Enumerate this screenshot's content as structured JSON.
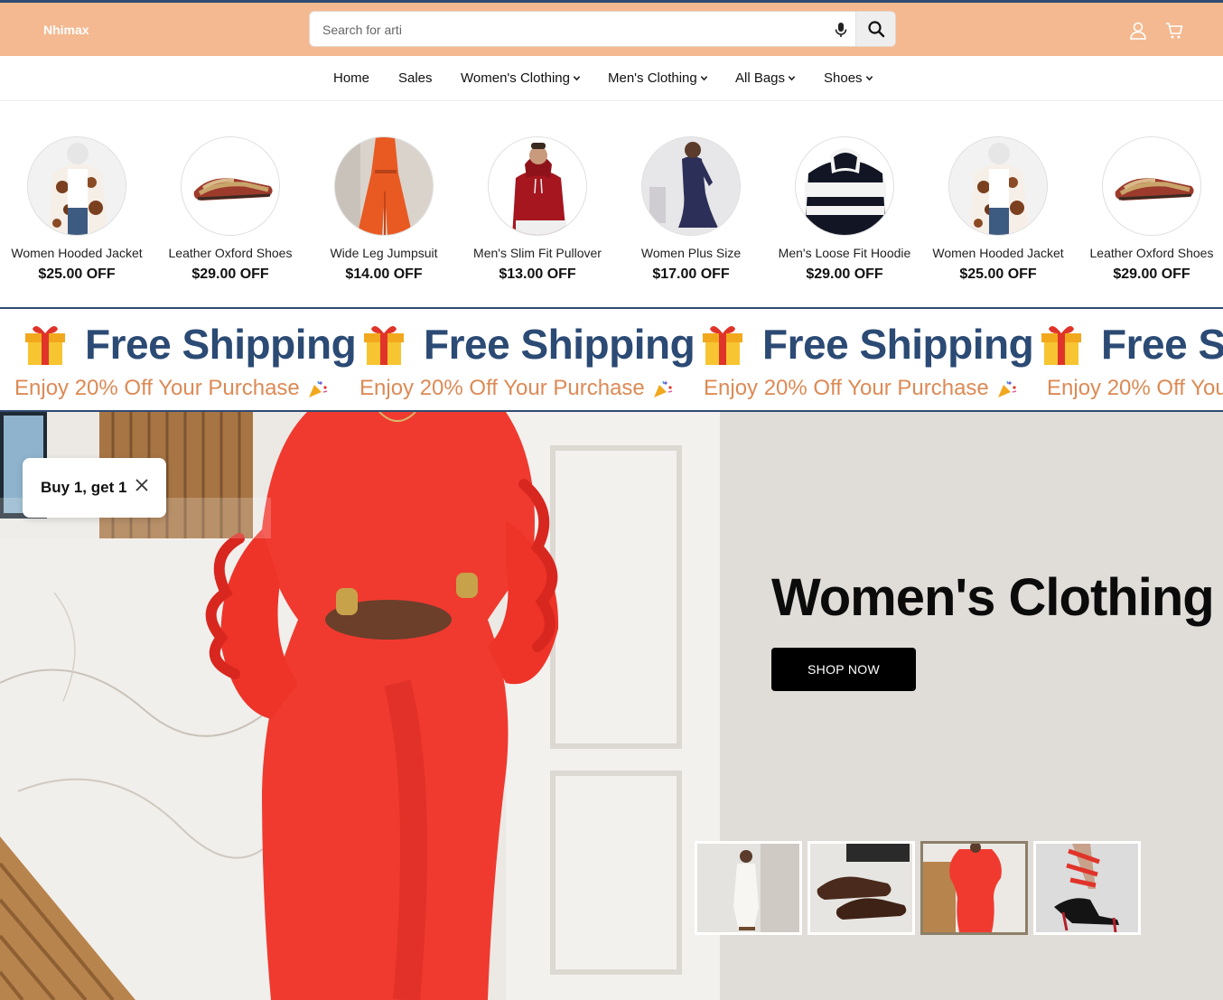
{
  "header": {
    "brand": "Nhimax",
    "search_placeholder": "Search for arti",
    "icons": [
      "mic-icon",
      "search-icon",
      "user-icon",
      "cart-icon"
    ]
  },
  "nav": {
    "items": [
      {
        "label": "Home",
        "dropdown": false
      },
      {
        "label": "Sales",
        "dropdown": false
      },
      {
        "label": "Women's Clothing",
        "dropdown": true
      },
      {
        "label": "Men's Clothing",
        "dropdown": true
      },
      {
        "label": "All Bags",
        "dropdown": true
      },
      {
        "label": "Shoes",
        "dropdown": true
      }
    ]
  },
  "categories": [
    {
      "name": "Women Hooded Jacket",
      "price": "$25.00 OFF"
    },
    {
      "name": "Leather Oxford Shoes",
      "price": "$29.00 OFF"
    },
    {
      "name": "Wide Leg Jumpsuit",
      "price": "$14.00 OFF"
    },
    {
      "name": "Men's Slim Fit Pullover",
      "price": "$13.00 OFF"
    },
    {
      "name": "Women Plus Size",
      "price": "$17.00 OFF"
    },
    {
      "name": "Men's Loose Fit Hoodie",
      "price": "$29.00 OFF"
    },
    {
      "name": "Women Hooded Jacket",
      "price": "$25.00 OFF"
    },
    {
      "name": "Leather Oxford Shoes",
      "price": "$29.00 OFF"
    }
  ],
  "promo": {
    "title": "Free Shipping",
    "subtitle": "Enjoy 20% Off Your Purchase"
  },
  "popup": {
    "text": "Buy 1, get 1"
  },
  "hero": {
    "title": "Women's Clothing",
    "button": "SHOP NOW",
    "active_thumbnail": 3
  },
  "colors": {
    "header_bg": "#f4b990",
    "header_border": "#2f4a73",
    "promo_title": "#2b4a74",
    "promo_sub": "#dc8a55",
    "hero_bg": "#e0dcd7",
    "dress_red": "#f03a30"
  }
}
